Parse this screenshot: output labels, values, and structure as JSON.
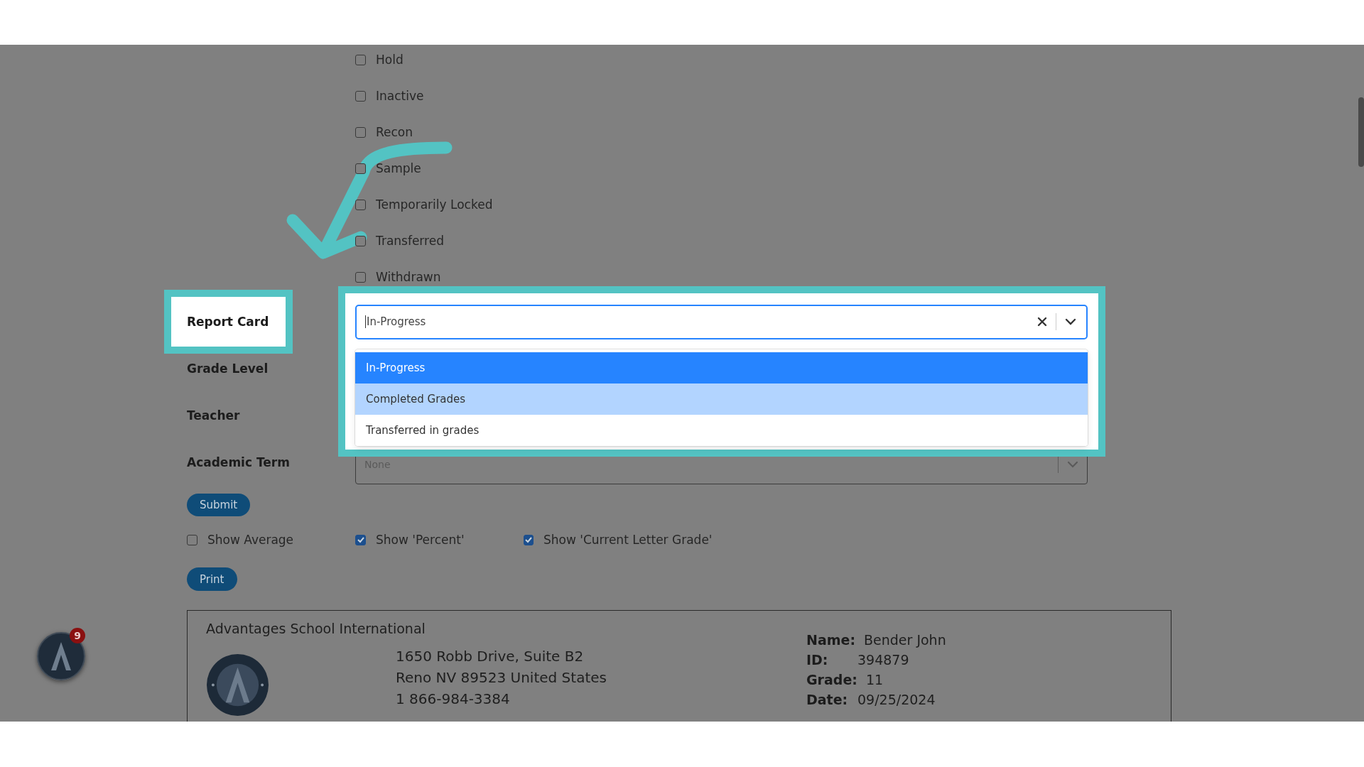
{
  "status_checkboxes": [
    {
      "label": "Hold",
      "checked": false
    },
    {
      "label": "Inactive",
      "checked": false
    },
    {
      "label": "Recon",
      "checked": false
    },
    {
      "label": "Sample",
      "checked": false
    },
    {
      "label": "Temporarily Locked",
      "checked": false
    },
    {
      "label": "Transferred",
      "checked": false
    },
    {
      "label": "Withdrawn",
      "checked": false
    }
  ],
  "form": {
    "report_card": {
      "label": "Report Card",
      "value": "In-Progress",
      "options": [
        {
          "label": "In-Progress",
          "selected": true,
          "highlighted": false
        },
        {
          "label": "Completed Grades",
          "selected": false,
          "highlighted": true
        },
        {
          "label": "Transferred in grades",
          "selected": false,
          "highlighted": false
        }
      ]
    },
    "grade_level": {
      "label": "Grade Level"
    },
    "teacher": {
      "label": "Teacher"
    },
    "academic_term": {
      "label": "Academic Term",
      "placeholder": "None"
    }
  },
  "submit_button": "Submit",
  "display_options": [
    {
      "label": "Show Average",
      "checked": false
    },
    {
      "label": "Show 'Percent'",
      "checked": true
    },
    {
      "label": "Show 'Current Letter Grade'",
      "checked": true
    }
  ],
  "print_button": "Print",
  "report": {
    "school_name": "Advantages School International",
    "address_lines": [
      "1650 Robb Drive, Suite B2",
      "Reno NV 89523 United States",
      "1 866-984-3384"
    ],
    "student": [
      {
        "label": "Name:",
        "value": "Bender John"
      },
      {
        "label": "ID:",
        "value": "394879"
      },
      {
        "label": "Grade:",
        "value": "11"
      },
      {
        "label": "Date:",
        "value": "09/25/2024"
      }
    ]
  },
  "notification_badge": "9"
}
